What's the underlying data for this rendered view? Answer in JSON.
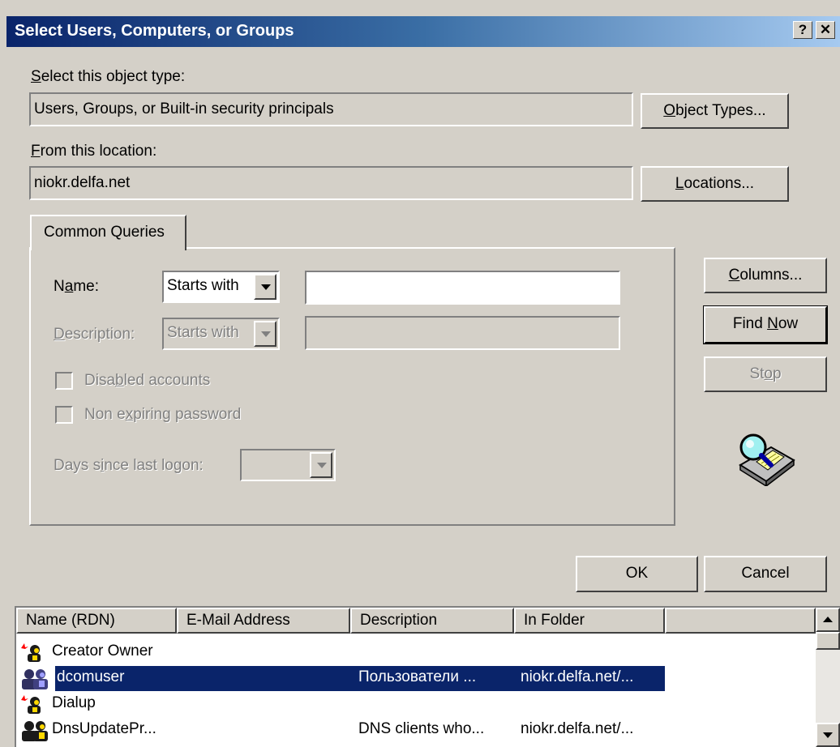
{
  "window": {
    "title": "Select Users, Computers, or Groups",
    "help_label": "?",
    "close_label": "✕"
  },
  "object_type": {
    "label_key": "S",
    "label_rest": "elect this object type:",
    "value": "Users, Groups, or Built-in security principals",
    "button_key": "O",
    "button_rest": "bject Types..."
  },
  "location": {
    "label_key": "F",
    "label_rest": "rom this location:",
    "value": "niokr.delfa.net",
    "button_key": "L",
    "button_rest": "ocations..."
  },
  "tab": {
    "label": "Common Queries"
  },
  "query": {
    "name_label_a": "N",
    "name_label_key": "a",
    "name_label_b": "me:",
    "name_match": "Starts with",
    "name_value": "",
    "desc_label_key": "D",
    "desc_label_rest": "escription:",
    "desc_match": "Starts with",
    "disabled_a": "Disa",
    "disabled_key": "b",
    "disabled_b": "led accounts",
    "nonexp_a": "Non e",
    "nonexp_key": "x",
    "nonexp_b": "piring password",
    "days_a": "Days s",
    "days_key": "i",
    "days_b": "nce last logon:"
  },
  "side_buttons": {
    "columns_key": "C",
    "columns_rest": "olumns...",
    "find_a": "Find ",
    "find_key": "N",
    "find_b": "ow",
    "stop_a": "St",
    "stop_key": "o",
    "stop_b": "p"
  },
  "ok_label": "OK",
  "cancel_label": "Cancel",
  "results": {
    "columns": [
      "Name (RDN)",
      "E-Mail Address",
      "Description",
      "In Folder"
    ],
    "rows": [
      {
        "name": "Creator Owner",
        "email": "",
        "description": "",
        "folder": "",
        "icon": "special-principal-icon",
        "selected": false
      },
      {
        "name": "dcomuser",
        "email": "",
        "description": "Пользователи ...",
        "folder": "niokr.delfa.net/...",
        "icon": "group-icon",
        "selected": true
      },
      {
        "name": "Dialup",
        "email": "",
        "description": "",
        "folder": "",
        "icon": "special-principal-icon",
        "selected": false
      },
      {
        "name": "DnsUpdatePr...",
        "email": "",
        "description": "DNS clients who...",
        "folder": "niokr.delfa.net/...",
        "icon": "group-icon",
        "selected": false
      }
    ]
  },
  "colors": {
    "title_start": "#0a246a",
    "title_end": "#a6caf0",
    "face": "#d4d0c8",
    "selection": "#0a246a"
  }
}
